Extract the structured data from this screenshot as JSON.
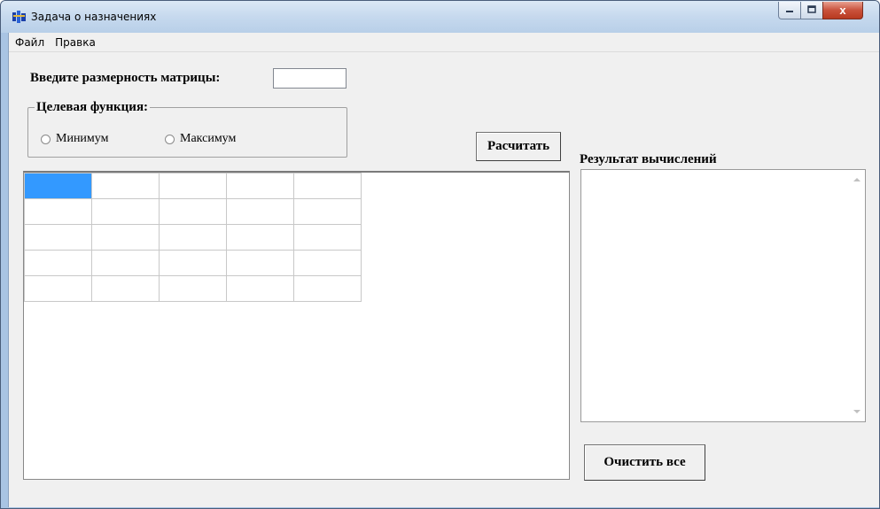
{
  "window": {
    "title": "Задача о назначениях",
    "close_glyph": "x"
  },
  "menu": {
    "items": [
      "Файл",
      "Правка"
    ]
  },
  "size": {
    "label": "Введите размерность матрицы:",
    "value": ""
  },
  "goal": {
    "legend": "Целевая функция:",
    "options": [
      {
        "label": "Минимум",
        "selected": false
      },
      {
        "label": "Максимум",
        "selected": false
      }
    ]
  },
  "actions": {
    "calc_label": "Расчитать",
    "clear_label": "Очистить все"
  },
  "matrix": {
    "rows": 5,
    "cols": 5,
    "selected_cell": [
      0,
      0
    ],
    "cells": [
      [
        "",
        "",
        "",
        "",
        ""
      ],
      [
        "",
        "",
        "",
        "",
        ""
      ],
      [
        "",
        "",
        "",
        "",
        ""
      ],
      [
        "",
        "",
        "",
        "",
        ""
      ],
      [
        "",
        "",
        "",
        "",
        ""
      ]
    ]
  },
  "result": {
    "label": "Результат вычислений",
    "text": ""
  },
  "colors": {
    "selected_cell": "#3399ff",
    "close_button": "#c9523c"
  },
  "icons": [
    "app-icon",
    "minimize-icon",
    "maximize-icon",
    "close-icon",
    "scroll-up-icon",
    "scroll-down-icon"
  ]
}
